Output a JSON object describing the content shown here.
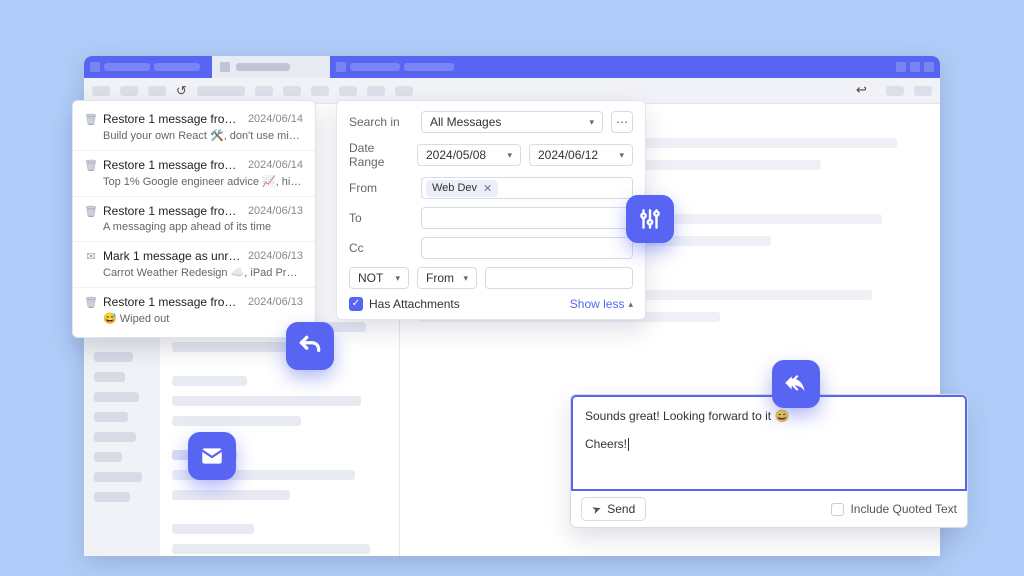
{
  "colors": {
    "accent": "#5865f2"
  },
  "restore_list": [
    {
      "icon": "trash",
      "title": "Restore 1 message from Trash",
      "date": "2024/06/14",
      "sub": "Build your own React 🛠️, don't use microservic…"
    },
    {
      "icon": "trash",
      "title": "Restore 1 message from Trash",
      "date": "2024/06/14",
      "sub": "Top 1% Google engineer advice 📈, high quality…"
    },
    {
      "icon": "trash",
      "title": "Restore 1 message from Trash",
      "date": "2024/06/13",
      "sub": "A messaging app ahead of its time"
    },
    {
      "icon": "unread",
      "title": "Mark 1 message as unread",
      "date": "2024/06/13",
      "sub": "Carrot Weather Redesign ☁️, iPad Pro Ad Revis…"
    },
    {
      "icon": "trash",
      "title": "Restore 1 message from Trash",
      "date": "2024/06/13",
      "sub": "😅 Wiped out"
    }
  ],
  "search": {
    "labels": {
      "search_in": "Search in",
      "date_range": "Date Range",
      "from": "From",
      "to": "To",
      "cc": "Cc"
    },
    "scope": "All Messages",
    "date_from": "2024/05/08",
    "date_to": "2024/06/12",
    "from_chip": "Web Dev",
    "not_label": "NOT",
    "not_field": "From",
    "has_attachments_label": "Has Attachments",
    "show_less": "Show less"
  },
  "compose": {
    "line1": "Sounds great! Looking forward to it 😄",
    "line2": "Cheers!",
    "send": "Send",
    "include_quoted": "Include Quoted Text"
  }
}
